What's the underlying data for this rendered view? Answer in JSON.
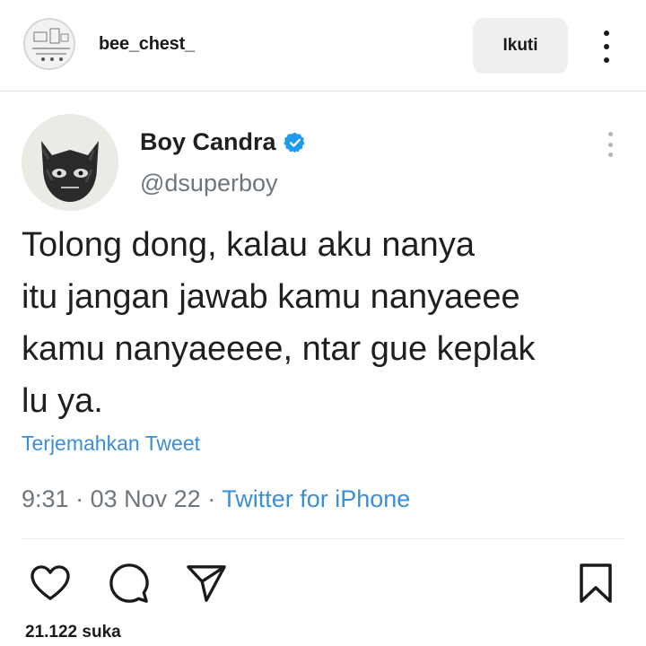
{
  "post": {
    "username": "bee_chest_",
    "follow_label": "Ikuti",
    "likes_text": "21.122 suka"
  },
  "tweet": {
    "display_name": "Boy Candra",
    "handle": "@dsuperboy",
    "verified": true,
    "text": "Tolong dong, kalau aku nanya\nitu jangan jawab kamu nanyaeee\nkamu nanyaeeee, ntar gue keplak\nlu ya.",
    "translate_label": "Terjemahkan Tweet",
    "time": "9:31",
    "date": "03 Nov 22",
    "source": "Twitter for iPhone"
  },
  "icons": {
    "like": "heart-icon",
    "comment": "comment-icon",
    "share": "send-icon",
    "save": "bookmark-icon",
    "more": "more-vertical-icon"
  },
  "colors": {
    "link_blue": "#3a8fd6",
    "verified_blue": "#1d9bf0",
    "muted_text": "#6e767d",
    "follow_button_bg": "#efefef"
  }
}
